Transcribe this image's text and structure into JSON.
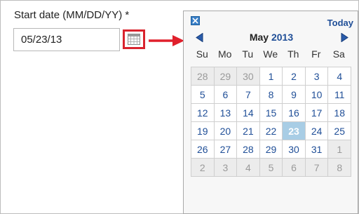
{
  "form": {
    "label": "Start date (MM/DD/YY) *",
    "date_value": "05/23/13",
    "calendar_button_icon": "calendar-icon",
    "arrow_icon": "right-arrow-icon",
    "highlight_color": "#d9232d"
  },
  "calendar": {
    "close_icon": "close-icon",
    "today_label": "Today",
    "prev_icon": "chevron-left-icon",
    "next_icon": "chevron-right-icon",
    "month": "May",
    "year": "2013",
    "weekdays": [
      "Su",
      "Mo",
      "Tu",
      "We",
      "Th",
      "Fr",
      "Sa"
    ],
    "selected_day": "23",
    "weeks": [
      [
        {
          "d": "28",
          "o": true
        },
        {
          "d": "29",
          "o": true
        },
        {
          "d": "30",
          "o": true
        },
        {
          "d": "1"
        },
        {
          "d": "2"
        },
        {
          "d": "3"
        },
        {
          "d": "4"
        }
      ],
      [
        {
          "d": "5"
        },
        {
          "d": "6"
        },
        {
          "d": "7"
        },
        {
          "d": "8"
        },
        {
          "d": "9"
        },
        {
          "d": "10"
        },
        {
          "d": "11"
        }
      ],
      [
        {
          "d": "12"
        },
        {
          "d": "13"
        },
        {
          "d": "14"
        },
        {
          "d": "15"
        },
        {
          "d": "16"
        },
        {
          "d": "17"
        },
        {
          "d": "18"
        }
      ],
      [
        {
          "d": "19"
        },
        {
          "d": "20"
        },
        {
          "d": "21"
        },
        {
          "d": "22"
        },
        {
          "d": "23",
          "s": true
        },
        {
          "d": "24"
        },
        {
          "d": "25"
        }
      ],
      [
        {
          "d": "26"
        },
        {
          "d": "27"
        },
        {
          "d": "28"
        },
        {
          "d": "29"
        },
        {
          "d": "30"
        },
        {
          "d": "31"
        },
        {
          "d": "1",
          "o": true
        }
      ],
      [
        {
          "d": "2",
          "o": true
        },
        {
          "d": "3",
          "o": true
        },
        {
          "d": "4",
          "o": true
        },
        {
          "d": "5",
          "o": true
        },
        {
          "d": "6",
          "o": true
        },
        {
          "d": "7",
          "o": true
        },
        {
          "d": "8",
          "o": true
        }
      ]
    ]
  }
}
